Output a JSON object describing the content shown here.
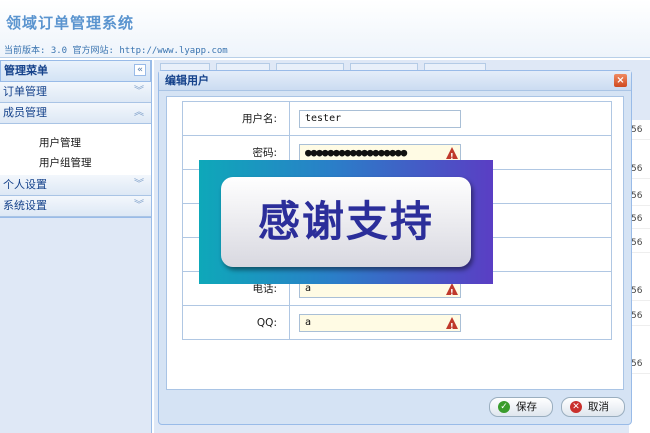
{
  "app": {
    "title": "领域订单管理系统",
    "version_line": "当前版本: 3.0 官方网站: http://www.lyapp.com"
  },
  "sidebar": {
    "header": "管理菜单",
    "collapse_glyph": "«",
    "groups": [
      {
        "label": "订单管理",
        "expanded": false
      },
      {
        "label": "成员管理",
        "expanded": true,
        "items": [
          "用户管理",
          "用户组管理"
        ]
      },
      {
        "label": "个人设置",
        "expanded": false
      },
      {
        "label": "系统设置",
        "expanded": false
      }
    ],
    "chevron_collapsed": "︾",
    "chevron_expanded": "︽"
  },
  "background_grid": {
    "cells": [
      "56",
      "56",
      "56",
      "56",
      "56",
      "56",
      "56",
      "56"
    ]
  },
  "dialog": {
    "title": "编辑用户",
    "close_glyph": "×",
    "fields": [
      {
        "label": "用户名:",
        "value": "tester",
        "type": "text",
        "invalid": false
      },
      {
        "label": "密码:",
        "value": "●●●●●●●●●●●●●●●●●●",
        "type": "password",
        "invalid": true
      },
      {
        "label": "电话:",
        "value": "a",
        "type": "text",
        "invalid": true
      },
      {
        "label": "QQ:",
        "value": "a",
        "type": "text",
        "invalid": true
      }
    ],
    "buttons": {
      "save": "保存",
      "cancel": "取消"
    }
  },
  "overlay": {
    "text": "感谢支持"
  },
  "colors": {
    "accent": "#15428b",
    "border": "#99bbe8",
    "warning": "#c0392b"
  }
}
